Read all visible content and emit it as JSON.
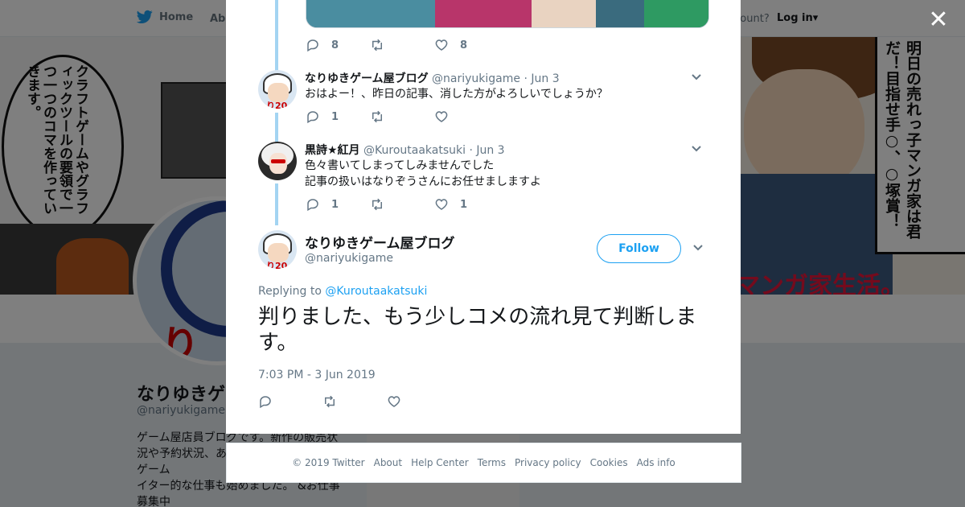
{
  "background": {
    "nav": {
      "home_label": "Home",
      "about_label": "Abo",
      "account_text": "ccount?",
      "login_label": "Log in"
    },
    "banner": {
      "left_bubble": "クラフトゲームやグラフィックツールの要領で一つ一つのコマを作っていきます。",
      "right_bubble": "明日の売れっ子マンガ家は君だ！目指せ手○、○塚賞！",
      "bottom_right_text": "マンガ家生活。"
    },
    "profile": {
      "name": "なりゆきゲ",
      "handle": "@nariyukigame",
      "bio": "ゲーム屋店員ブログです。新作の販売状況や予約状況、あ　　　　　ニュースにゲーム　　　　　書いています。 あとライター的な仕事も始めました。 &お仕事募集中"
    },
    "ads_text": "Ads info"
  },
  "modal": {
    "close_label": "✕",
    "first_tweet_actions": {
      "reply_count": "8",
      "retweet_count": "",
      "like_count": "8"
    },
    "replies": [
      {
        "name": "なりゆきゲーム屋ブログ",
        "handle": "@nariyukigame",
        "date": "Jun 3",
        "text": "おはよー！、昨日の記事、消した方がよろしいでしょうか？",
        "reply_count": "1",
        "retweet_count": "",
        "like_count": ""
      },
      {
        "name": "黒詩★紅月",
        "handle": "@Kuroutaakatsuki",
        "date": "Jun 3",
        "text_line1": "色々書いてしまってしみませんでした",
        "text_line2": "記事の扱いはなりぞうさんにお任せましますよ",
        "reply_count": "1",
        "retweet_count": "",
        "like_count": "1"
      }
    ],
    "main_tweet": {
      "name": "なりゆきゲーム屋ブログ",
      "handle": "@nariyukigame",
      "follow_label": "Follow",
      "replying_prefix": "Replying to ",
      "replying_to": "@Kuroutaakatsuki",
      "text": "判りました、もう少しコメの流れ見て判断します。",
      "timestamp": "7:03 PM - 3 Jun 2019"
    }
  },
  "footer": {
    "copyright": "© 2019 Twitter",
    "links": [
      "About",
      "Help Center",
      "Terms",
      "Privacy policy",
      "Cookies",
      "Ads info"
    ]
  },
  "colors": {
    "twitter_blue": "#1da1f2",
    "thread_line": "#a3d4f2",
    "muted": "#657786"
  }
}
